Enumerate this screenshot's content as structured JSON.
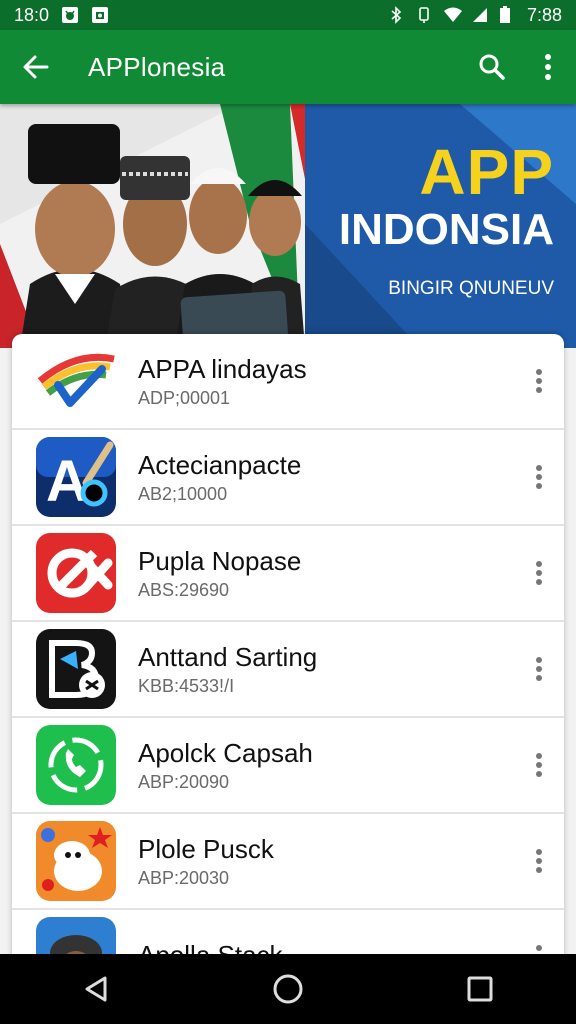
{
  "status_bar": {
    "time": "18:0",
    "clock": "7:88",
    "left_icons": [
      "cat-notification-icon",
      "camera-notification-icon"
    ],
    "right_icons": [
      "bluetooth-icon",
      "vibrate-icon",
      "wifi-icon",
      "signal-icon",
      "battery-icon"
    ]
  },
  "app_bar": {
    "title": "APPlonesia",
    "back_icon": "arrow-left-icon",
    "search_icon": "search-icon",
    "menu_icon": "more-vert-icon"
  },
  "banner": {
    "title_line1": "APP",
    "title_line2": "INDONSIA",
    "subtitle": "BINGIR QNUNEUV"
  },
  "apps": [
    {
      "name": "APPA lindayas",
      "code": "ADP;00001",
      "icon": "rainbow-check-icon"
    },
    {
      "name": "Actecianpacte",
      "code": "AB2;10000",
      "icon": "letter-a-pen-icon"
    },
    {
      "name": "Pupla Nopase",
      "code": "ABS:29690",
      "icon": "red-no-symbol-icon"
    },
    {
      "name": "Anttand Sarting",
      "code": "KBB:4533!/I",
      "icon": "letter-b-shield-icon"
    },
    {
      "name": "Apolck Capsah",
      "code": "ABP:20090",
      "icon": "green-phone-icon"
    },
    {
      "name": "Plole Pusck",
      "code": "ABP:20030",
      "icon": "cartoon-mascot-icon"
    },
    {
      "name": "Apolla Stack",
      "code": "",
      "icon": "person-photo-icon"
    }
  ],
  "nav": {
    "back": "triangle-back-icon",
    "home": "circle-home-icon",
    "recents": "square-recents-icon"
  },
  "colors": {
    "status_bar": "#0b6e2b",
    "app_bar": "#118a35",
    "banner_blue": "#1f5aa8",
    "banner_yellow": "#f7d21c"
  }
}
